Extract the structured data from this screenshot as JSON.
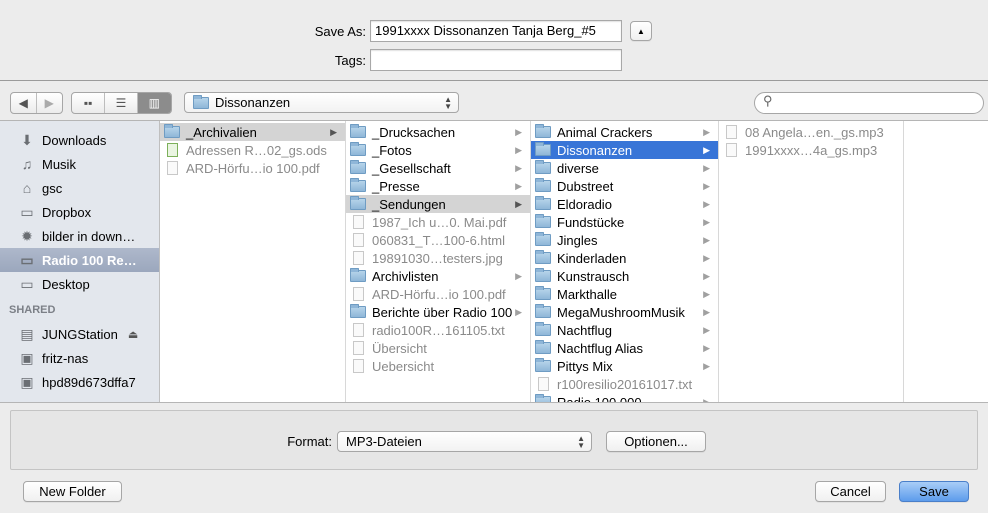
{
  "save_as": {
    "label": "Save As:",
    "value": "1991xxxx Dissonanzen Tanja Berg_#5"
  },
  "tags": {
    "label": "Tags:",
    "value": ""
  },
  "toolbar": {
    "location": "Dissonanzen",
    "search_placeholder": ""
  },
  "sidebar": {
    "favorites": [
      {
        "label": "Downloads",
        "icon": "download-icon"
      },
      {
        "label": "Musik",
        "icon": "music-note-icon"
      },
      {
        "label": "gsc",
        "icon": "home-icon"
      },
      {
        "label": "Dropbox",
        "icon": "folder-icon"
      },
      {
        "label": "bilder in down…",
        "icon": "gear-icon"
      },
      {
        "label": "Radio 100 Re…",
        "icon": "folder-icon",
        "selected": true
      },
      {
        "label": "Desktop",
        "icon": "desktop-icon"
      }
    ],
    "shared_heading": "SHARED",
    "shared": [
      {
        "label": "JUNGStation",
        "icon": "server-icon",
        "eject": true
      },
      {
        "label": "fritz-nas",
        "icon": "display-icon"
      },
      {
        "label": "hpd89d673dffa7",
        "icon": "display-icon"
      }
    ]
  },
  "columns": [
    [
      {
        "name": "_Archivalien",
        "type": "folder",
        "state": "path"
      },
      {
        "name": "Adressen R…02_gs.ods",
        "type": "ods"
      },
      {
        "name": "ARD-Hörfu…io 100.pdf",
        "type": "file"
      }
    ],
    [
      {
        "name": "_Drucksachen",
        "type": "folder"
      },
      {
        "name": "_Fotos",
        "type": "folder"
      },
      {
        "name": "_Gesellschaft",
        "type": "folder"
      },
      {
        "name": "_Presse",
        "type": "folder"
      },
      {
        "name": "_Sendungen",
        "type": "folder",
        "state": "path"
      },
      {
        "name": "1987_Ich u…0. Mai.pdf",
        "type": "file"
      },
      {
        "name": "060831_T…100-6.html",
        "type": "file"
      },
      {
        "name": "19891030…testers.jpg",
        "type": "file"
      },
      {
        "name": "Archivlisten",
        "type": "folder"
      },
      {
        "name": "ARD-Hörfu…io 100.pdf",
        "type": "file"
      },
      {
        "name": "Berichte über Radio 100",
        "type": "folder"
      },
      {
        "name": "radio100R…161105.txt",
        "type": "file"
      },
      {
        "name": "Übersicht",
        "type": "file"
      },
      {
        "name": "Uebersicht",
        "type": "file"
      }
    ],
    [
      {
        "name": "Animal Crackers",
        "type": "folder"
      },
      {
        "name": "Dissonanzen",
        "type": "folder",
        "state": "sel"
      },
      {
        "name": "diverse",
        "type": "folder"
      },
      {
        "name": "Dubstreet",
        "type": "folder"
      },
      {
        "name": "Eldoradio",
        "type": "folder"
      },
      {
        "name": "Fundstücke",
        "type": "folder"
      },
      {
        "name": "Jingles",
        "type": "folder"
      },
      {
        "name": "Kinderladen",
        "type": "folder"
      },
      {
        "name": "Kunstrausch",
        "type": "folder"
      },
      {
        "name": "Markthalle",
        "type": "folder"
      },
      {
        "name": "MegaMushroomMusik",
        "type": "folder"
      },
      {
        "name": "Nachtflug",
        "type": "folder"
      },
      {
        "name": "Nachtflug Alias",
        "type": "folder"
      },
      {
        "name": "Pittys Mix",
        "type": "folder"
      },
      {
        "name": "r100resilio20161017.txt",
        "type": "file"
      },
      {
        "name": "Radio 100 000",
        "type": "folder"
      }
    ],
    [
      {
        "name": "08 Angela…en._gs.mp3",
        "type": "file"
      },
      {
        "name": "1991xxxx…4a_gs.mp3",
        "type": "file"
      }
    ]
  ],
  "format": {
    "label": "Format:",
    "value": "MP3-Dateien",
    "options_button": "Optionen..."
  },
  "buttons": {
    "new_folder": "New Folder",
    "cancel": "Cancel",
    "save": "Save"
  },
  "colors": {
    "selection": "#3875d7",
    "save_button": "#6fa8ef"
  }
}
